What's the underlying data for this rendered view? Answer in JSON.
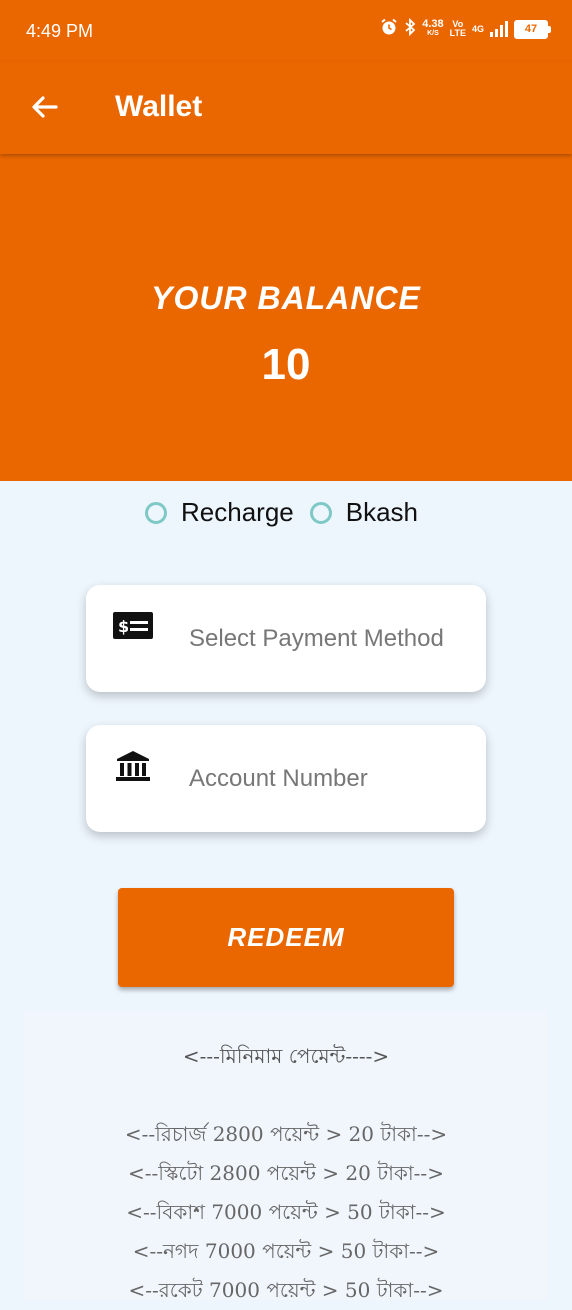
{
  "status": {
    "time": "4:49 PM",
    "net_speed": "4.38",
    "net_unit": "K/S",
    "volte_top": "Vo",
    "volte_bottom": "LTE",
    "net_type": "4G",
    "battery": "47"
  },
  "app_bar": {
    "title": "Wallet"
  },
  "balance": {
    "label": "YOUR BALANCE",
    "value": "10"
  },
  "radio": {
    "options": [
      "Recharge",
      "Bkash"
    ]
  },
  "fields": {
    "payment_method": {
      "placeholder": "Select Payment Method",
      "icon": "money-bill-icon"
    },
    "account_number": {
      "placeholder": "Account Number",
      "icon": "bank-icon"
    }
  },
  "redeem_label": "REDEEM",
  "info": {
    "heading": "<---মিনিমাম পেমেন্ট---->",
    "lines": [
      "<--রিচার্জ 2800 পয়েন্ট > 20 টাকা-->",
      "<--স্কিটো 2800 পয়েন্ট > 20 টাকা-->",
      "<--বিকাশ 7000 পয়েন্ট > 50 টাকা-->",
      "<--নগদ 7000 পয়েন্ট > 50 টাকা-->",
      "<--রকেট 7000 পয়েন্ট > 50 টাকা-->"
    ]
  },
  "colors": {
    "accent": "#ea6700",
    "background": "#edf5fd",
    "radio": "#7ec9c6"
  }
}
